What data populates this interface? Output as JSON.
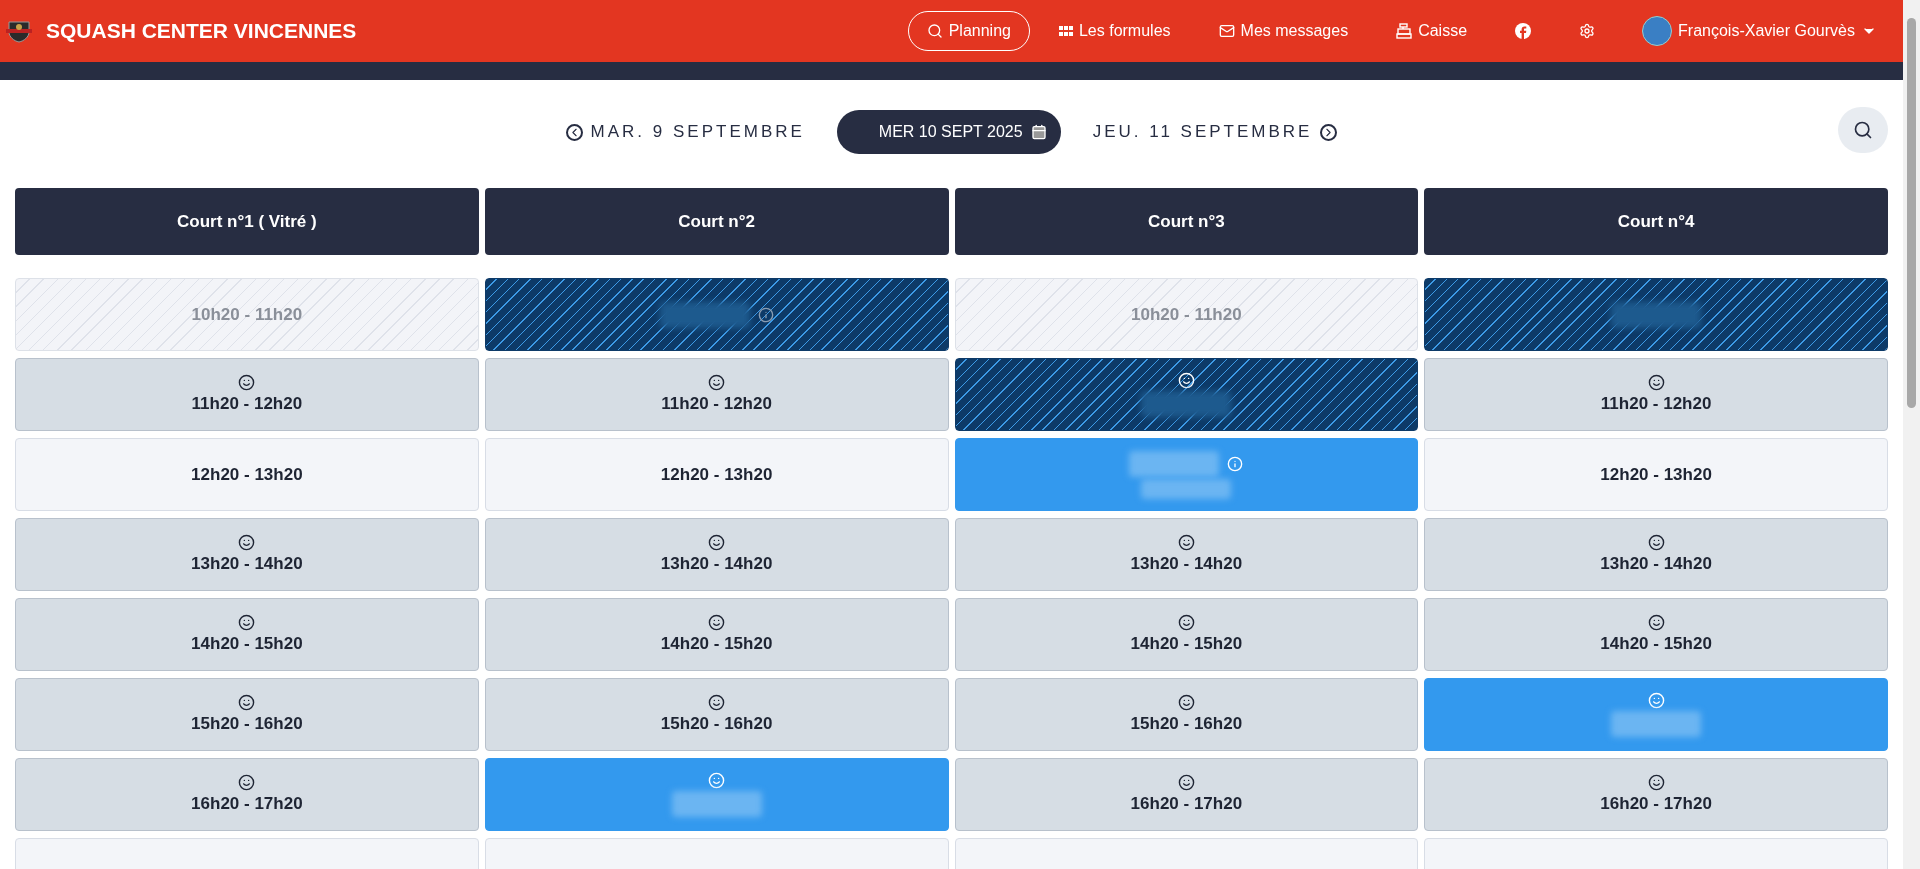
{
  "brand": {
    "title": "SQUASH CENTER VINCENNES"
  },
  "nav": [
    {
      "kind": "search",
      "label": "Planning",
      "selected": true
    },
    {
      "kind": "grid",
      "label": "Les formules",
      "selected": false
    },
    {
      "kind": "mail",
      "label": "Mes messages",
      "selected": false
    },
    {
      "kind": "register",
      "label": "Caisse",
      "selected": false
    },
    {
      "kind": "facebook",
      "selected": false
    },
    {
      "kind": "settings",
      "selected": false
    }
  ],
  "user": {
    "name": "François-Xavier Gourvès"
  },
  "date_nav": {
    "previous": "MAR. 9 SEPTEMBRE",
    "current": "MER 10 SEPT 2025",
    "next": "JEU. 11 SEPTEMBRE"
  },
  "courts": [
    "Court n°1 ( Vitré )",
    "Court n°2",
    "Court n°3",
    "Court n°4"
  ],
  "rows": [
    [
      {
        "kind": "past",
        "time": "10h20 - 11h20"
      },
      {
        "kind": "booked-hatched",
        "info": true
      },
      {
        "kind": "past",
        "time": "10h20 - 11h20"
      },
      {
        "kind": "booked-hatched"
      }
    ],
    [
      {
        "kind": "free",
        "smiley": true,
        "time": "11h20 - 12h20"
      },
      {
        "kind": "free",
        "smiley": true,
        "time": "11h20 - 12h20"
      },
      {
        "kind": "booked-hatched",
        "smiley": true
      },
      {
        "kind": "free",
        "smiley": true,
        "time": "11h20 - 12h20"
      }
    ],
    [
      {
        "kind": "open",
        "time": "12h20 - 13h20"
      },
      {
        "kind": "open",
        "time": "12h20 - 13h20"
      },
      {
        "kind": "booked",
        "info": true
      },
      {
        "kind": "open",
        "time": "12h20 - 13h20"
      }
    ],
    [
      {
        "kind": "free",
        "smiley": true,
        "time": "13h20 - 14h20"
      },
      {
        "kind": "free",
        "smiley": true,
        "time": "13h20 - 14h20"
      },
      {
        "kind": "free",
        "smiley": true,
        "time": "13h20 - 14h20"
      },
      {
        "kind": "free",
        "smiley": true,
        "time": "13h20 - 14h20"
      }
    ],
    [
      {
        "kind": "free",
        "smiley": true,
        "time": "14h20 - 15h20"
      },
      {
        "kind": "free",
        "smiley": true,
        "time": "14h20 - 15h20"
      },
      {
        "kind": "free",
        "smiley": true,
        "time": "14h20 - 15h20"
      },
      {
        "kind": "free",
        "smiley": true,
        "time": "14h20 - 15h20"
      }
    ],
    [
      {
        "kind": "free",
        "smiley": true,
        "time": "15h20 - 16h20"
      },
      {
        "kind": "free",
        "smiley": true,
        "time": "15h20 - 16h20"
      },
      {
        "kind": "free",
        "smiley": true,
        "time": "15h20 - 16h20"
      },
      {
        "kind": "booked",
        "smiley": true
      }
    ],
    [
      {
        "kind": "free",
        "smiley": true,
        "time": "16h20 - 17h20"
      },
      {
        "kind": "booked",
        "smiley": true
      },
      {
        "kind": "free",
        "smiley": true,
        "time": "16h20 - 17h20"
      },
      {
        "kind": "free",
        "smiley": true,
        "time": "16h20 - 17h20"
      }
    ],
    [
      {
        "kind": "open"
      },
      {
        "kind": "open"
      },
      {
        "kind": "open"
      },
      {
        "kind": "open"
      }
    ]
  ]
}
